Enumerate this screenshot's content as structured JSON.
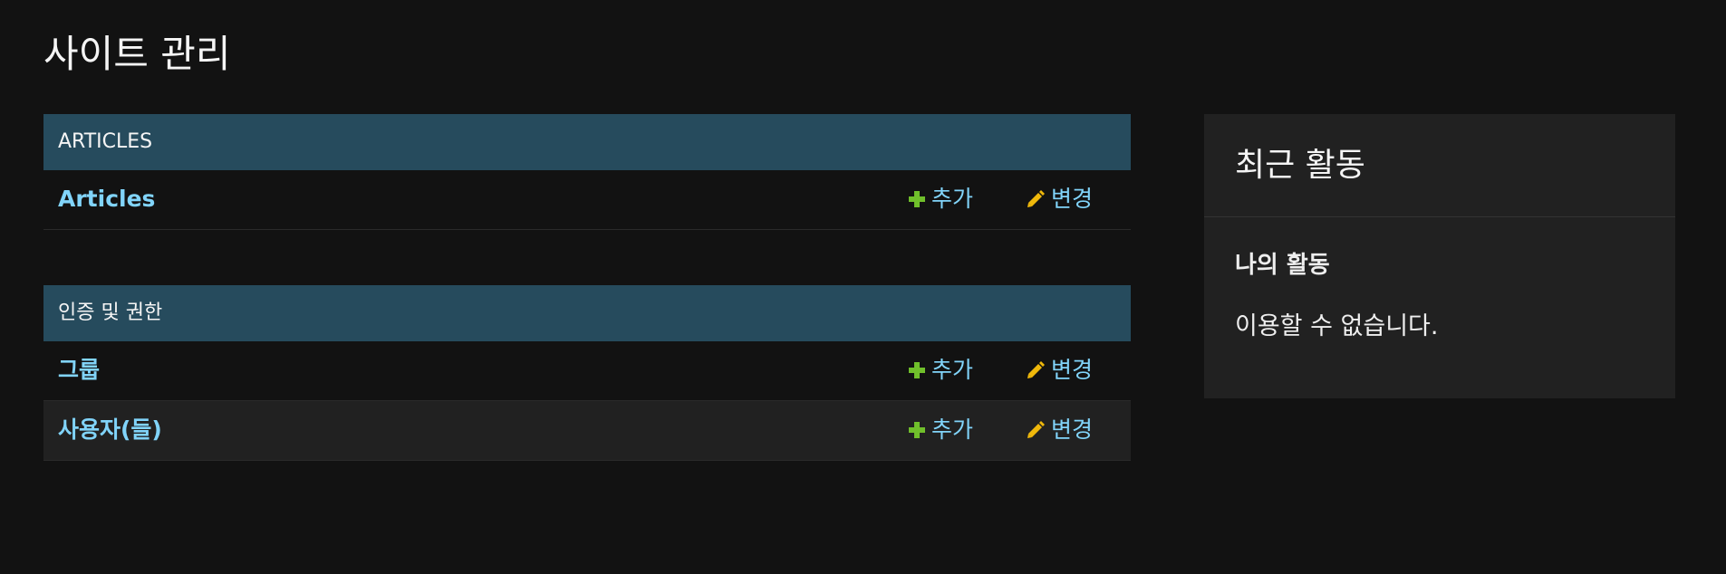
{
  "page": {
    "title": "사이트 관리"
  },
  "apps": [
    {
      "caption": "ARTICLES",
      "models": [
        {
          "name": "Articles",
          "add_label": "추가",
          "change_label": "변경"
        }
      ]
    },
    {
      "caption": "인증 및 권한",
      "models": [
        {
          "name": "그룹",
          "add_label": "추가",
          "change_label": "변경"
        },
        {
          "name": "사용자(들)",
          "add_label": "추가",
          "change_label": "변경"
        }
      ]
    }
  ],
  "recent_actions": {
    "title": "최근 활동",
    "subtitle": "나의 활동",
    "empty_text": "이용할 수 없습니다."
  },
  "icons": {
    "add": "plus-icon",
    "change": "pencil-icon"
  },
  "colors": {
    "background": "#121212",
    "caption_bg": "#264b5d",
    "link": "#81d4fa",
    "add_icon": "#70bf2b",
    "change_icon": "#efb80b",
    "panel_bg": "#212121"
  }
}
